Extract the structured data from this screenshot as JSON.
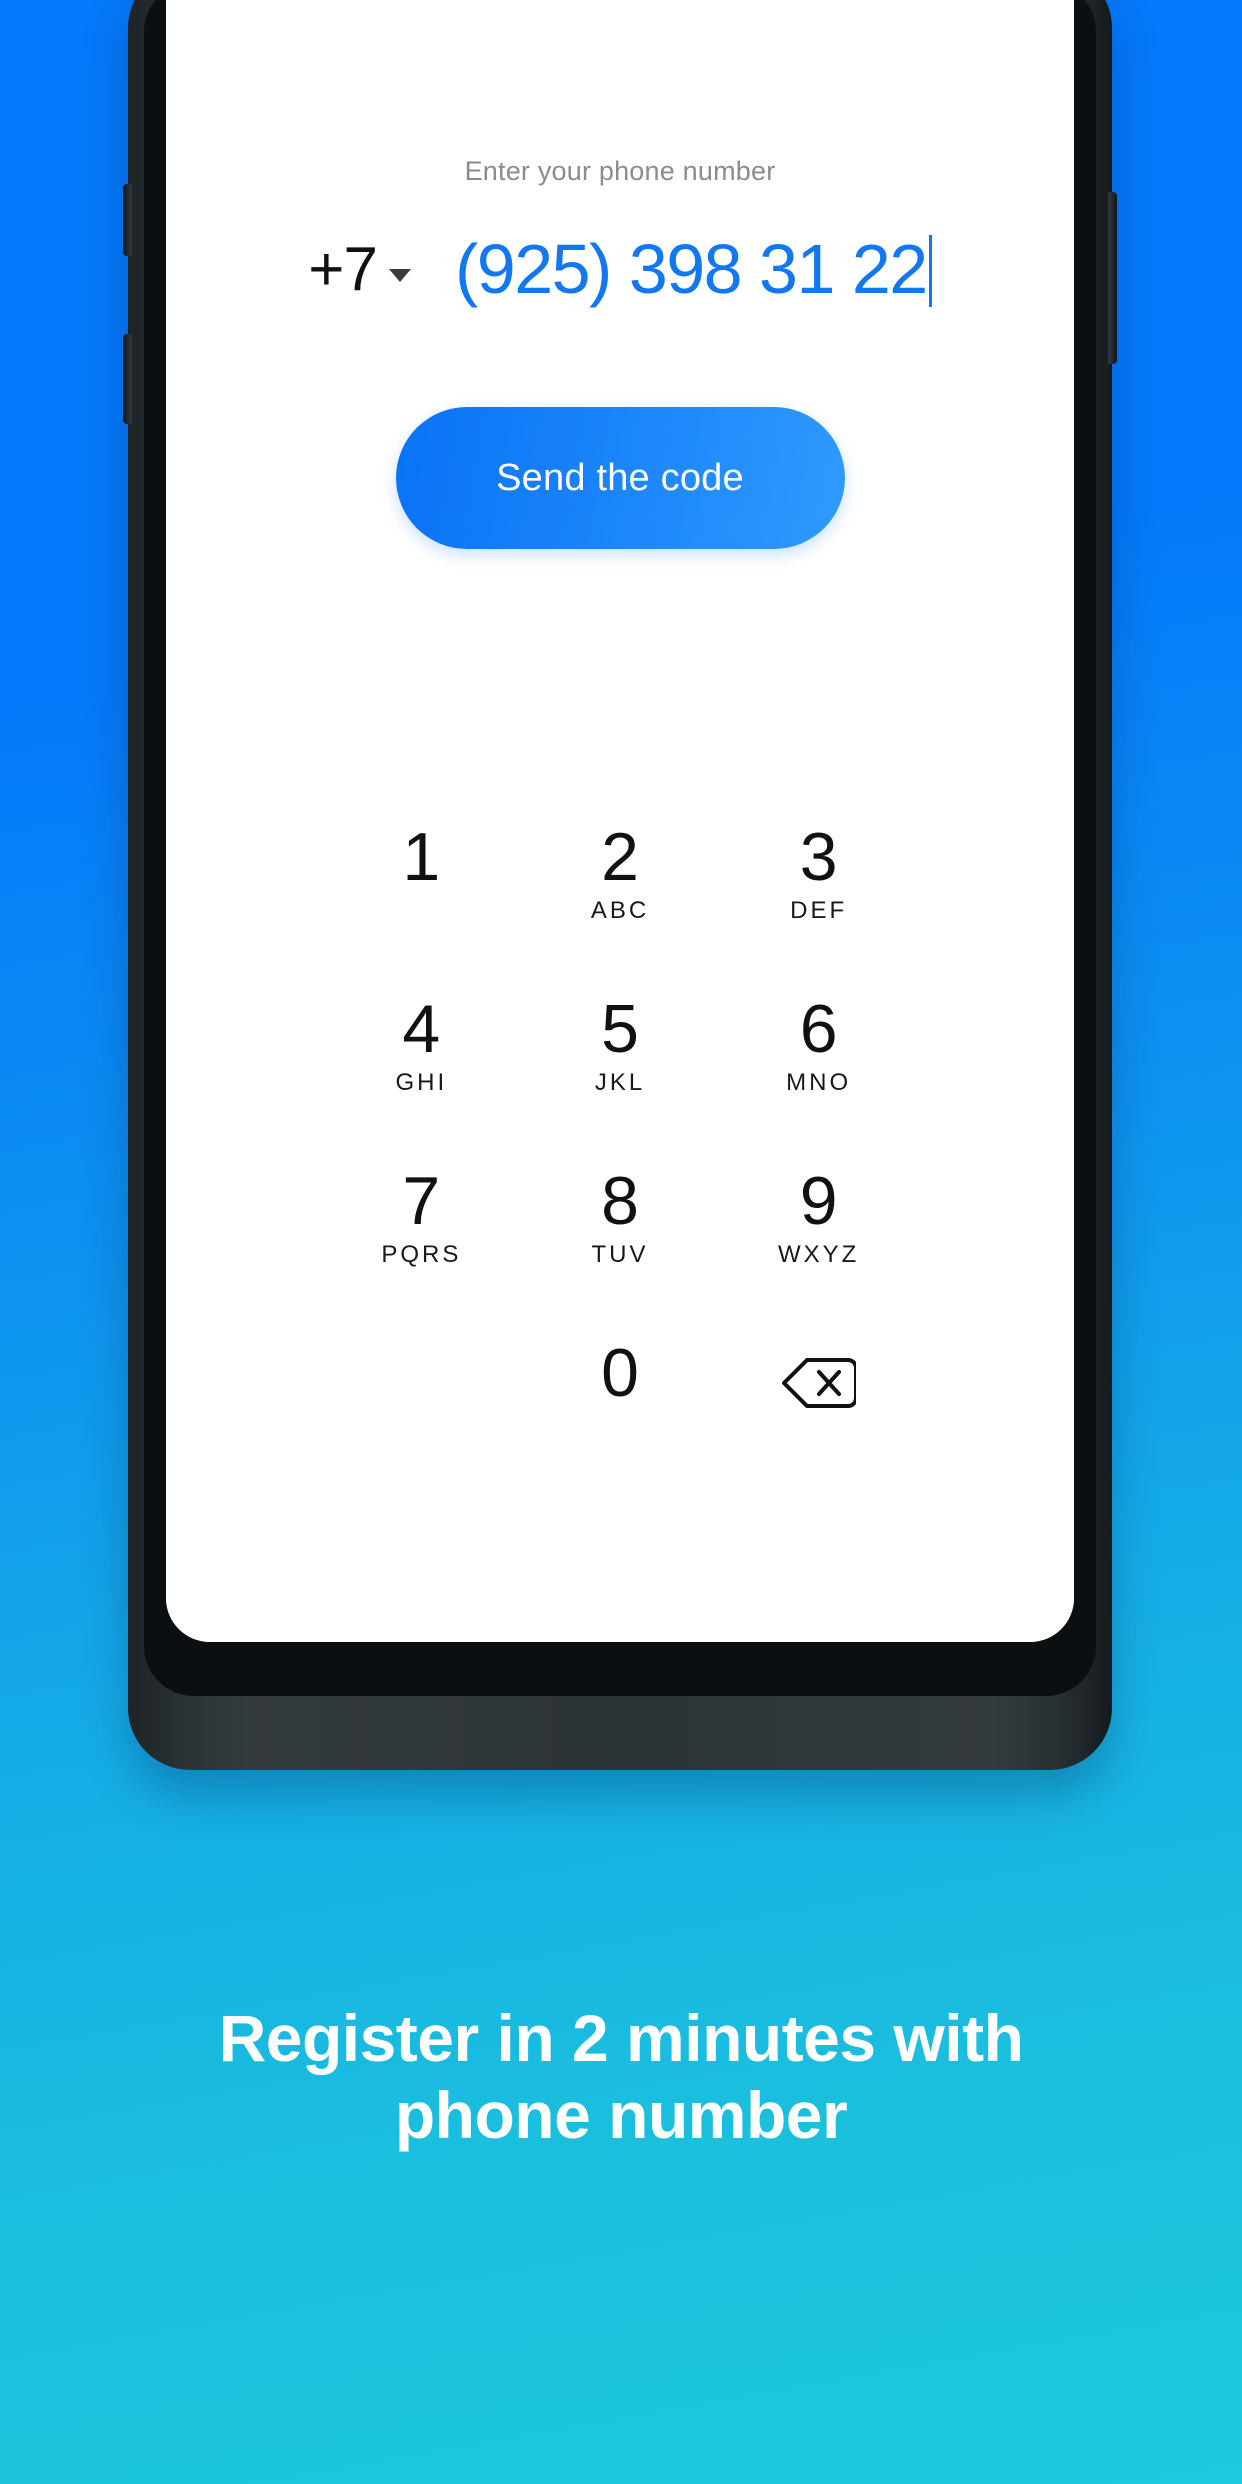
{
  "background": {
    "gradient_from": "#0579FB",
    "gradient_to": "#1DC9DF"
  },
  "device": {
    "frame_color": "#2c3337",
    "buttons": {
      "volume_up": "volume-up-button",
      "volume_down": "volume-down-button",
      "power": "power-button"
    }
  },
  "screen": {
    "hint": "Enter your phone number",
    "country_code": "+7",
    "country_dropdown_icon": "chevron-down-icon",
    "phone_number": "(925) 398 31 22",
    "text_cursor_visible": true,
    "number_color": "#1178F0",
    "hint_color": "#8b8b90",
    "send_button": {
      "label": "Send the code",
      "color_from": "#0a72f5",
      "color_to": "#2f9bfd",
      "text_color": "#ffffff"
    }
  },
  "keypad": {
    "rows": [
      [
        {
          "digit": "1",
          "letters": ""
        },
        {
          "digit": "2",
          "letters": "ABC"
        },
        {
          "digit": "3",
          "letters": "DEF"
        }
      ],
      [
        {
          "digit": "4",
          "letters": "GHI"
        },
        {
          "digit": "5",
          "letters": "JKL"
        },
        {
          "digit": "6",
          "letters": "MNO"
        }
      ],
      [
        {
          "digit": "7",
          "letters": "PQRS"
        },
        {
          "digit": "8",
          "letters": "TUV"
        },
        {
          "digit": "9",
          "letters": "WXYZ"
        }
      ]
    ],
    "last_row": {
      "zero": "0",
      "backspace_icon": "backspace-icon"
    }
  },
  "caption": {
    "line1": "Register in 2 minutes with",
    "line2": "phone number",
    "color": "#ffffff"
  }
}
